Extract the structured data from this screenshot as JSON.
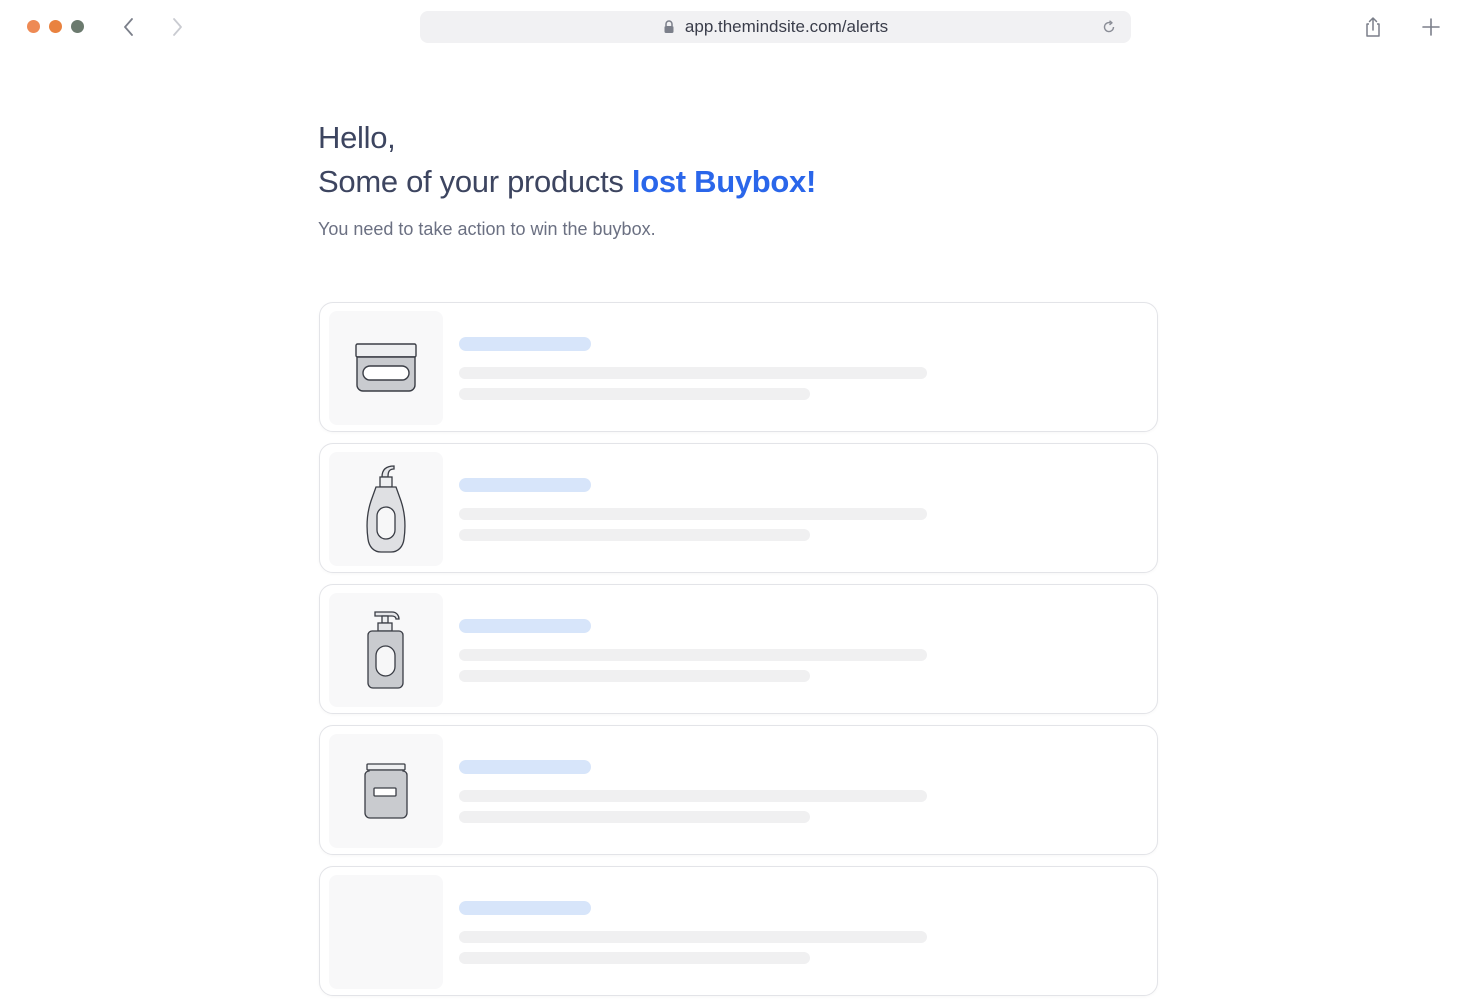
{
  "browser": {
    "url": "app.themindsite.com/alerts",
    "traffic_lights": [
      "#ee8a54",
      "#e9823f",
      "#6b7a6e"
    ]
  },
  "content": {
    "greeting": "Hello,",
    "headline_prefix": "Some of your products ",
    "headline_accent": "lost Buybox!",
    "subtext": "You need to take action to win the buybox."
  },
  "colors": {
    "accent": "#2a66ea",
    "skeleton_title": "#d7e5fa",
    "skeleton_line": "#f0f0f1"
  },
  "products": [
    {
      "icon": "cream-jar-icon"
    },
    {
      "icon": "lotion-bottle-icon"
    },
    {
      "icon": "pump-bottle-icon"
    },
    {
      "icon": "supplement-jar-icon"
    },
    {
      "icon": "product-placeholder"
    }
  ]
}
